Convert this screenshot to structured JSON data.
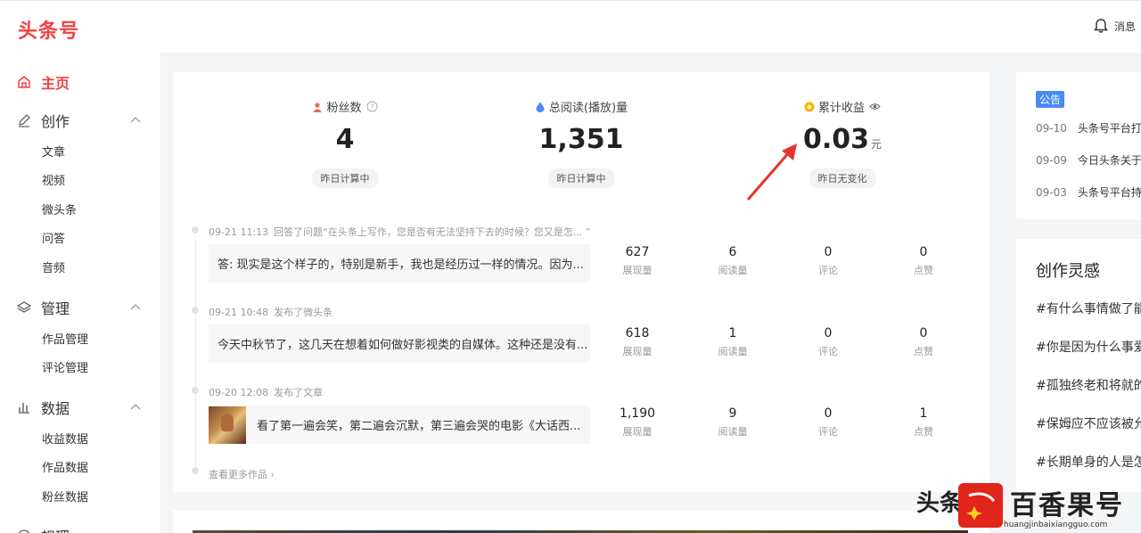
{
  "header": {
    "logo": "头条号",
    "message_label": "消息"
  },
  "sidebar": {
    "home": "主页",
    "create": {
      "label": "创作",
      "items": [
        "文章",
        "视频",
        "微头条",
        "问答",
        "音频"
      ]
    },
    "manage": {
      "label": "管理",
      "items": [
        "作品管理",
        "评论管理"
      ]
    },
    "data": {
      "label": "数据",
      "items": [
        "收益数据",
        "作品数据",
        "粉丝数据"
      ]
    },
    "more": "规理"
  },
  "stats": [
    {
      "label": "粉丝数",
      "value": "4",
      "unit": "",
      "chip": "昨日计算中",
      "icon": "user-icon",
      "color": "#f0654f"
    },
    {
      "label": "总阅读(播放)量",
      "value": "1,351",
      "unit": "",
      "chip": "昨日计算中",
      "icon": "drop-icon",
      "color": "#4a8af4"
    },
    {
      "label": "累计收益",
      "value": "0.03",
      "unit": "元",
      "chip": "昨日无变化",
      "icon": "coin-icon",
      "color": "#f5b400"
    }
  ],
  "feed": [
    {
      "time": "09-21 11:13",
      "action": "回答了问题“在头条上写作，您是否有无法坚持下去的时候？您又是怎... ”",
      "text": "答: 现实是这个样子的，特别是新手，我也是经历过一样的情况。因为...",
      "metrics": [
        {
          "n": "627",
          "t": "展现量"
        },
        {
          "n": "6",
          "t": "阅读量"
        },
        {
          "n": "0",
          "t": "评论"
        },
        {
          "n": "0",
          "t": "点赞"
        }
      ]
    },
    {
      "time": "09-21 10:48",
      "action": "发布了微头条",
      "text": "今天中秋节了，这几天在想着如何做好影视类的自媒体。这种还是没有...",
      "metrics": [
        {
          "n": "618",
          "t": "展现量"
        },
        {
          "n": "1",
          "t": "阅读量"
        },
        {
          "n": "0",
          "t": "评论"
        },
        {
          "n": "0",
          "t": "点赞"
        }
      ]
    },
    {
      "time": "09-20 12:08",
      "action": "发布了文章",
      "text": "看了第一遍会笑，第二遍会沉默，第三遍会哭的电影《大话西...",
      "metrics": [
        {
          "n": "1,190",
          "t": "展现量"
        },
        {
          "n": "9",
          "t": "阅读量"
        },
        {
          "n": "0",
          "t": "评论"
        },
        {
          "n": "1",
          "t": "点赞"
        }
      ]
    }
  ],
  "more_works": "查看更多作品",
  "notices": {
    "badge": "公告",
    "items": [
      {
        "date": "09-10",
        "title": "头条号平台打"
      },
      {
        "date": "09-09",
        "title": "今日头条关于"
      },
      {
        "date": "09-03",
        "title": "头条号平台持"
      }
    ]
  },
  "inspiration": {
    "title": "创作灵感",
    "topics": [
      "#有什么事情做了能",
      "#你是因为什么事爱",
      "#孤独终老和将就的",
      "#保姆应不应该被允",
      "#长期单身的人是怎"
    ]
  },
  "watermark": {
    "left": "头条",
    "brand": "百香果号",
    "url": "huangjinbaixiangguo.com"
  }
}
